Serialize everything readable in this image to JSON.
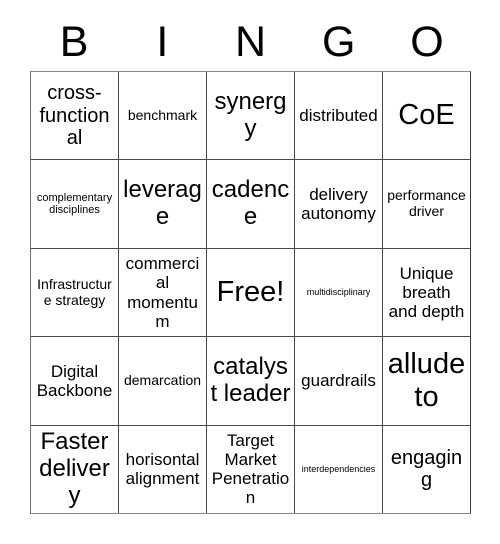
{
  "card": {
    "header_letters": [
      "B",
      "I",
      "N",
      "G",
      "O"
    ],
    "rows": [
      {
        "cells": [
          {
            "text": "cross-functional",
            "size": "lg"
          },
          {
            "text": "benchmark",
            "size": "sm"
          },
          {
            "text": "synergy",
            "size": "xl"
          },
          {
            "text": "distributed",
            "size": "md"
          },
          {
            "text": "CoE",
            "size": "xxl"
          }
        ]
      },
      {
        "cells": [
          {
            "text": "complementary disciplines",
            "size": "xs"
          },
          {
            "text": "leverage",
            "size": "xl"
          },
          {
            "text": "cadence",
            "size": "xl"
          },
          {
            "text": "delivery autonomy",
            "size": "md"
          },
          {
            "text": "performance driver",
            "size": "sm"
          }
        ]
      },
      {
        "cells": [
          {
            "text": "Infrastructure strategy",
            "size": "sm"
          },
          {
            "text": "commercial momentum",
            "size": "md"
          },
          {
            "text": "Free!",
            "size": "xxl"
          },
          {
            "text": "multidisciplinary",
            "size": "xxs"
          },
          {
            "text": "Unique breath and depth",
            "size": "md"
          }
        ]
      },
      {
        "cells": [
          {
            "text": "Digital Backbone",
            "size": "md"
          },
          {
            "text": "demarcation",
            "size": "sm"
          },
          {
            "text": "catalyst leader",
            "size": "xl"
          },
          {
            "text": "guardrails",
            "size": "md"
          },
          {
            "text": "allude to",
            "size": "xxl"
          }
        ]
      },
      {
        "cells": [
          {
            "text": "Faster delivery",
            "size": "xl"
          },
          {
            "text": "horisontal alignment",
            "size": "md"
          },
          {
            "text": "Target Market Penetration",
            "size": "md"
          },
          {
            "text": "interdependencies",
            "size": "xxs"
          },
          {
            "text": "engaging",
            "size": "lg"
          }
        ]
      }
    ]
  }
}
